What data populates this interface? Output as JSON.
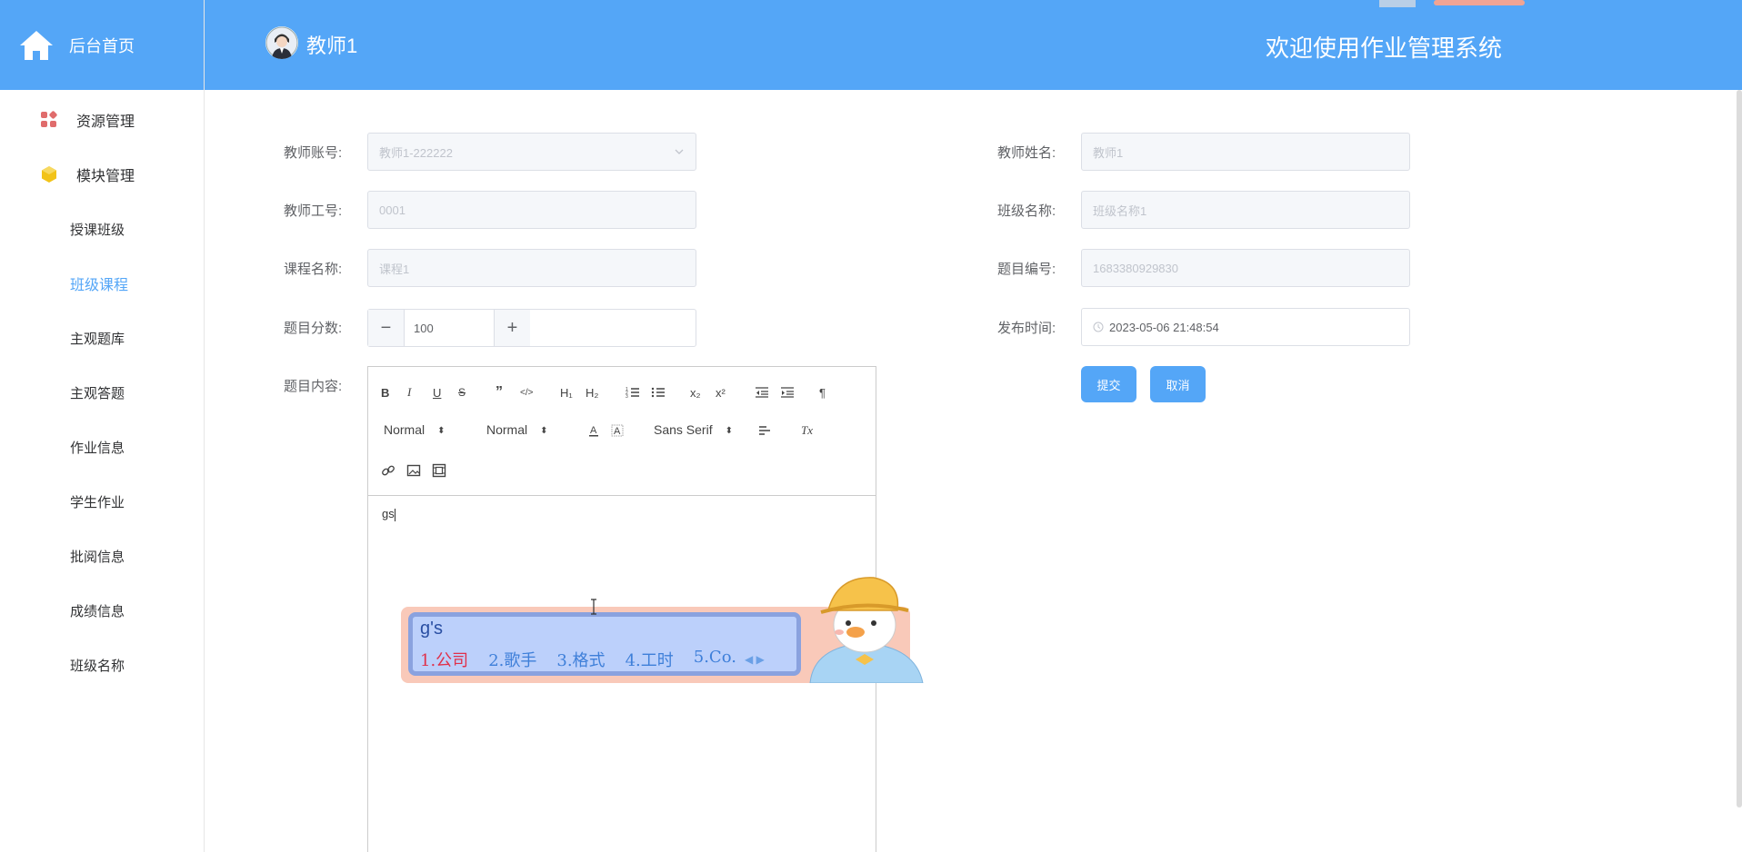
{
  "sidebar": {
    "brand": "后台首页",
    "groups": [
      {
        "label": "资源管理",
        "icon": "grid-icon",
        "color": "#e06c6c"
      },
      {
        "label": "模块管理",
        "icon": "cube-icon",
        "color": "#f2c318"
      }
    ],
    "items": [
      {
        "label": "授课班级",
        "active": false
      },
      {
        "label": "班级课程",
        "active": true
      },
      {
        "label": "主观题库",
        "active": false
      },
      {
        "label": "主观答题",
        "active": false
      },
      {
        "label": "作业信息",
        "active": false
      },
      {
        "label": "学生作业",
        "active": false
      },
      {
        "label": "批阅信息",
        "active": false
      },
      {
        "label": "成绩信息",
        "active": false
      },
      {
        "label": "班级名称",
        "active": false
      }
    ]
  },
  "header": {
    "username": "教师1",
    "welcome": "欢迎使用作业管理系统",
    "bg_color": "#54a6f7"
  },
  "form": {
    "teacher_account_label": "教师账号:",
    "teacher_account_value": "教师1-222222",
    "teacher_name_label": "教师姓名:",
    "teacher_name_value": "教师1",
    "teacher_no_label": "教师工号:",
    "teacher_no_value": "0001",
    "class_name_label": "班级名称:",
    "class_name_value": "班级名称1",
    "course_name_label": "课程名称:",
    "course_name_value": "课程1",
    "question_no_label": "题目编号:",
    "question_no_value": "1683380929830",
    "score_label": "题目分数:",
    "score_value": "100",
    "score_minus": "−",
    "score_plus": "+",
    "publish_time_label": "发布时间:",
    "publish_time_value": "2023-05-06 21:48:54",
    "content_label": "题目内容:",
    "submit_label": "提交",
    "cancel_label": "取消"
  },
  "editor": {
    "size_select": "Normal",
    "header_select": "Normal",
    "font_select": "Sans Serif",
    "content": "gs",
    "buttons": {
      "bold": "B",
      "italic": "I",
      "underline": "U",
      "strike": "S",
      "quote": "”",
      "code": "</>",
      "h1": "H₁",
      "h2": "H₂",
      "sub": "x₂",
      "sup": "x²",
      "clean": "Tx",
      "rtl": "¶"
    }
  },
  "ime": {
    "composition": "g's",
    "candidates": [
      "1.公司",
      "2.歌手",
      "3.格式",
      "4.工时",
      "5.Co."
    ],
    "nav": "◀ ▶"
  }
}
